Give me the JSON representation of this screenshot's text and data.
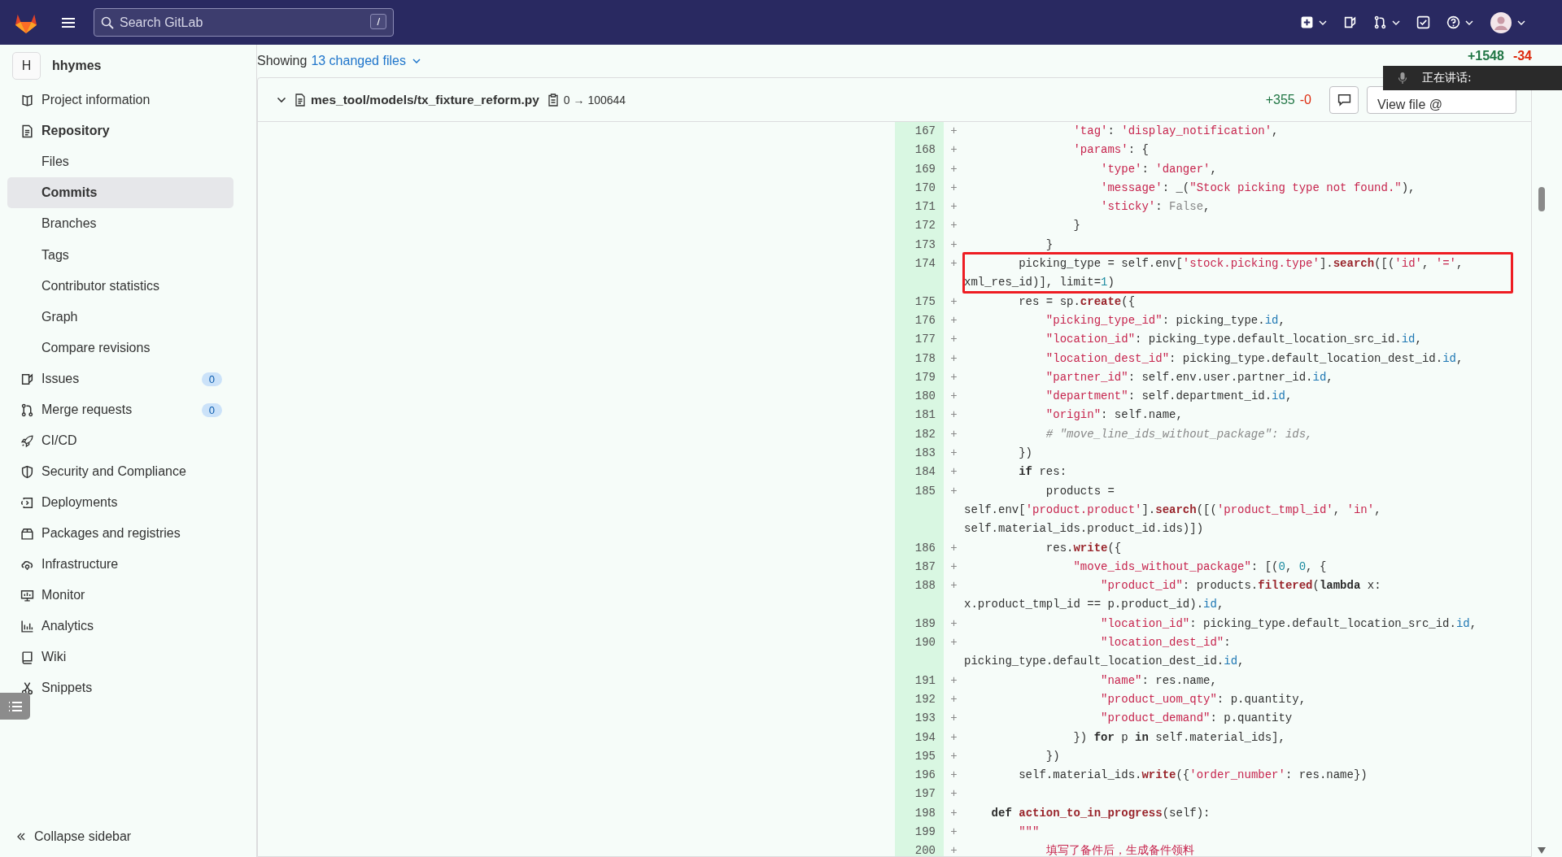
{
  "top_bar": {
    "search": {
      "placeholder": "Search GitLab",
      "shortcut": "/"
    }
  },
  "sidebar": {
    "project": {
      "initial": "H",
      "name": "hhymes"
    },
    "items": [
      {
        "label": "Project information",
        "selected": false
      },
      {
        "label": "Repository",
        "selected": false,
        "expanded": true,
        "children": [
          {
            "label": "Files",
            "selected": false
          },
          {
            "label": "Commits",
            "selected": true
          },
          {
            "label": "Branches",
            "selected": false
          },
          {
            "label": "Tags",
            "selected": false
          },
          {
            "label": "Contributor statistics",
            "selected": false
          },
          {
            "label": "Graph",
            "selected": false
          },
          {
            "label": "Compare revisions",
            "selected": false
          }
        ]
      },
      {
        "label": "Issues",
        "selected": false,
        "count": "0"
      },
      {
        "label": "Merge requests",
        "selected": false,
        "count": "0"
      },
      {
        "label": "CI/CD",
        "selected": false
      },
      {
        "label": "Security and Compliance",
        "selected": false
      },
      {
        "label": "Deployments",
        "selected": false
      },
      {
        "label": "Packages and registries",
        "selected": false
      },
      {
        "label": "Infrastructure",
        "selected": false
      },
      {
        "label": "Monitor",
        "selected": false
      },
      {
        "label": "Analytics",
        "selected": false
      },
      {
        "label": "Wiki",
        "selected": false
      },
      {
        "label": "Snippets",
        "selected": false
      }
    ],
    "collapse": "Collapse sidebar"
  },
  "summary": {
    "prefix": "Showing",
    "link": "13 changed files",
    "additions": "+1548",
    "deletions": "-34"
  },
  "voice_overlay": {
    "text": "正在讲话:"
  },
  "file": {
    "path": "mes_tool/models/tx_fixture_reform.py",
    "mode": "0 → 100644",
    "additions": "+355",
    "deletions": "-0",
    "view_button": "View file @",
    "expanded": true,
    "lines": [
      {
        "number": "167",
        "sign": "+",
        "highlighted": false,
        "tokens": [
          {
            "kind": "str",
            "text": "                'tag'"
          },
          {
            "kind": "plain",
            "text": ": "
          },
          {
            "kind": "str",
            "text": "'display_notification'"
          },
          {
            "kind": "plain",
            "text": ","
          }
        ]
      },
      {
        "number": "168",
        "sign": "+",
        "highlighted": false,
        "tokens": [
          {
            "kind": "str",
            "text": "                'params'"
          },
          {
            "kind": "plain",
            "text": ": {"
          }
        ]
      },
      {
        "number": "169",
        "sign": "+",
        "highlighted": false,
        "tokens": [
          {
            "kind": "str",
            "text": "                    'type'"
          },
          {
            "kind": "plain",
            "text": ": "
          },
          {
            "kind": "str",
            "text": "'danger'"
          },
          {
            "kind": "plain",
            "text": ","
          }
        ]
      },
      {
        "number": "170",
        "sign": "+",
        "highlighted": false,
        "tokens": [
          {
            "kind": "str",
            "text": "                    'message'"
          },
          {
            "kind": "plain",
            "text": ": _("
          },
          {
            "kind": "str",
            "text": "\"Stock picking type not found.\""
          },
          {
            "kind": "plain",
            "text": "),"
          }
        ]
      },
      {
        "number": "171",
        "sign": "+",
        "highlighted": false,
        "tokens": [
          {
            "kind": "str",
            "text": "                    'sticky'"
          },
          {
            "kind": "plain",
            "text": ": "
          },
          {
            "kind": "const",
            "text": "False"
          },
          {
            "kind": "plain",
            "text": ","
          }
        ]
      },
      {
        "number": "172",
        "sign": "+",
        "highlighted": false,
        "tokens": [
          {
            "kind": "plain",
            "text": "                }"
          }
        ]
      },
      {
        "number": "173",
        "sign": "+",
        "highlighted": false,
        "tokens": [
          {
            "kind": "plain",
            "text": "            }"
          }
        ]
      },
      {
        "number": "174",
        "sign": "+",
        "highlighted": true,
        "tokens": [
          {
            "kind": "plain",
            "text": "        picking_type = self.env["
          },
          {
            "kind": "str",
            "text": "'stock.picking.type'"
          },
          {
            "kind": "plain",
            "text": "]."
          },
          {
            "kind": "fn",
            "text": "search"
          },
          {
            "kind": "plain",
            "text": "([("
          },
          {
            "kind": "str",
            "text": "'id'"
          },
          {
            "kind": "plain",
            "text": ", "
          },
          {
            "kind": "str",
            "text": "'='"
          },
          {
            "kind": "plain",
            "text": ", xml_res_id)], limit="
          },
          {
            "kind": "num",
            "text": "1"
          },
          {
            "kind": "plain",
            "text": ")"
          }
        ]
      },
      {
        "number": "175",
        "sign": "+",
        "highlighted": false,
        "tokens": [
          {
            "kind": "plain",
            "text": "        res = sp."
          },
          {
            "kind": "fn",
            "text": "create"
          },
          {
            "kind": "plain",
            "text": "({"
          }
        ]
      },
      {
        "number": "176",
        "sign": "+",
        "highlighted": false,
        "tokens": [
          {
            "kind": "str",
            "text": "            \"picking_type_id\""
          },
          {
            "kind": "plain",
            "text": ": picking_type."
          },
          {
            "kind": "attr",
            "text": "id"
          },
          {
            "kind": "plain",
            "text": ","
          }
        ]
      },
      {
        "number": "177",
        "sign": "+",
        "highlighted": false,
        "tokens": [
          {
            "kind": "str",
            "text": "            \"location_id\""
          },
          {
            "kind": "plain",
            "text": ": picking_type.default_location_src_id."
          },
          {
            "kind": "attr",
            "text": "id"
          },
          {
            "kind": "plain",
            "text": ","
          }
        ]
      },
      {
        "number": "178",
        "sign": "+",
        "highlighted": false,
        "tokens": [
          {
            "kind": "str",
            "text": "            \"location_dest_id\""
          },
          {
            "kind": "plain",
            "text": ": picking_type.default_location_dest_id."
          },
          {
            "kind": "attr",
            "text": "id"
          },
          {
            "kind": "plain",
            "text": ","
          }
        ]
      },
      {
        "number": "179",
        "sign": "+",
        "highlighted": false,
        "tokens": [
          {
            "kind": "str",
            "text": "            \"partner_id\""
          },
          {
            "kind": "plain",
            "text": ": self.env.user.partner_id."
          },
          {
            "kind": "attr",
            "text": "id"
          },
          {
            "kind": "plain",
            "text": ","
          }
        ]
      },
      {
        "number": "180",
        "sign": "+",
        "highlighted": false,
        "tokens": [
          {
            "kind": "str",
            "text": "            \"department\""
          },
          {
            "kind": "plain",
            "text": ": self.department_id."
          },
          {
            "kind": "attr",
            "text": "id"
          },
          {
            "kind": "plain",
            "text": ","
          }
        ]
      },
      {
        "number": "181",
        "sign": "+",
        "highlighted": false,
        "tokens": [
          {
            "kind": "str",
            "text": "            \"origin\""
          },
          {
            "kind": "plain",
            "text": ": self.name,"
          }
        ]
      },
      {
        "number": "182",
        "sign": "+",
        "highlighted": false,
        "tokens": [
          {
            "kind": "comment",
            "text": "            # \"move_line_ids_without_package\": ids,"
          }
        ]
      },
      {
        "number": "183",
        "sign": "+",
        "highlighted": false,
        "tokens": [
          {
            "kind": "plain",
            "text": "        })"
          }
        ]
      },
      {
        "number": "184",
        "sign": "+",
        "highlighted": false,
        "tokens": [
          {
            "kind": "kw",
            "text": "        if"
          },
          {
            "kind": "plain",
            "text": " res:"
          }
        ]
      },
      {
        "number": "185",
        "sign": "+",
        "highlighted": false,
        "tokens": [
          {
            "kind": "plain",
            "text": "            products = self.env["
          },
          {
            "kind": "str",
            "text": "'product.product'"
          },
          {
            "kind": "plain",
            "text": "]."
          },
          {
            "kind": "fn",
            "text": "search"
          },
          {
            "kind": "plain",
            "text": "([("
          },
          {
            "kind": "str",
            "text": "'product_tmpl_id'"
          },
          {
            "kind": "plain",
            "text": ", "
          },
          {
            "kind": "str",
            "text": "'in'"
          },
          {
            "kind": "plain",
            "text": ", self.material_ids.product_id.ids)])"
          }
        ]
      },
      {
        "number": "186",
        "sign": "+",
        "highlighted": false,
        "tokens": [
          {
            "kind": "plain",
            "text": "            res."
          },
          {
            "kind": "fn",
            "text": "write"
          },
          {
            "kind": "plain",
            "text": "({"
          }
        ]
      },
      {
        "number": "187",
        "sign": "+",
        "highlighted": false,
        "tokens": [
          {
            "kind": "str",
            "text": "                \"move_ids_without_package\""
          },
          {
            "kind": "plain",
            "text": ": [("
          },
          {
            "kind": "num",
            "text": "0"
          },
          {
            "kind": "plain",
            "text": ", "
          },
          {
            "kind": "num",
            "text": "0"
          },
          {
            "kind": "plain",
            "text": ", {"
          }
        ]
      },
      {
        "number": "188",
        "sign": "+",
        "highlighted": false,
        "tokens": [
          {
            "kind": "str",
            "text": "                    \"product_id\""
          },
          {
            "kind": "plain",
            "text": ": products."
          },
          {
            "kind": "fn",
            "text": "filtered"
          },
          {
            "kind": "plain",
            "text": "("
          },
          {
            "kind": "kw",
            "text": "lambda"
          },
          {
            "kind": "plain",
            "text": " x: x.product_tmpl_id == p.product_id)."
          },
          {
            "kind": "attr",
            "text": "id"
          },
          {
            "kind": "plain",
            "text": ","
          }
        ]
      },
      {
        "number": "189",
        "sign": "+",
        "highlighted": false,
        "tokens": [
          {
            "kind": "str",
            "text": "                    \"location_id\""
          },
          {
            "kind": "plain",
            "text": ": picking_type.default_location_src_id."
          },
          {
            "kind": "attr",
            "text": "id"
          },
          {
            "kind": "plain",
            "text": ","
          }
        ]
      },
      {
        "number": "190",
        "sign": "+",
        "highlighted": false,
        "tokens": [
          {
            "kind": "str",
            "text": "                    \"location_dest_id\""
          },
          {
            "kind": "plain",
            "text": ": picking_type.default_location_dest_id."
          },
          {
            "kind": "attr",
            "text": "id"
          },
          {
            "kind": "plain",
            "text": ","
          }
        ]
      },
      {
        "number": "191",
        "sign": "+",
        "highlighted": false,
        "tokens": [
          {
            "kind": "str",
            "text": "                    \"name\""
          },
          {
            "kind": "plain",
            "text": ": res.name,"
          }
        ]
      },
      {
        "number": "192",
        "sign": "+",
        "highlighted": false,
        "tokens": [
          {
            "kind": "str",
            "text": "                    \"product_uom_qty\""
          },
          {
            "kind": "plain",
            "text": ": p.quantity,"
          }
        ]
      },
      {
        "number": "193",
        "sign": "+",
        "highlighted": false,
        "tokens": [
          {
            "kind": "str",
            "text": "                    \"product_demand\""
          },
          {
            "kind": "plain",
            "text": ": p.quantity"
          }
        ]
      },
      {
        "number": "194",
        "sign": "+",
        "highlighted": false,
        "tokens": [
          {
            "kind": "plain",
            "text": "                }) "
          },
          {
            "kind": "kw",
            "text": "for"
          },
          {
            "kind": "plain",
            "text": " p "
          },
          {
            "kind": "kw",
            "text": "in"
          },
          {
            "kind": "plain",
            "text": " self.material_ids],"
          }
        ]
      },
      {
        "number": "195",
        "sign": "+",
        "highlighted": false,
        "tokens": [
          {
            "kind": "plain",
            "text": "            })"
          }
        ]
      },
      {
        "number": "196",
        "sign": "+",
        "highlighted": false,
        "tokens": [
          {
            "kind": "plain",
            "text": "        self.material_ids."
          },
          {
            "kind": "fn",
            "text": "write"
          },
          {
            "kind": "plain",
            "text": "({"
          },
          {
            "kind": "str",
            "text": "'order_number'"
          },
          {
            "kind": "plain",
            "text": ": res.name})"
          }
        ]
      },
      {
        "number": "197",
        "sign": "+",
        "highlighted": false
      },
      {
        "number": "198",
        "sign": "+",
        "highlighted": false,
        "tokens": [
          {
            "kind": "kw",
            "text": "    def"
          },
          {
            "kind": "fn",
            "text": " action_to_in_progress"
          },
          {
            "kind": "plain",
            "text": "(self):"
          }
        ]
      },
      {
        "number": "199",
        "sign": "+",
        "highlighted": false,
        "tokens": [
          {
            "kind": "str",
            "text": "        \"\"\""
          }
        ]
      },
      {
        "number": "200",
        "sign": "+",
        "highlighted": false,
        "tokens": [
          {
            "kind": "str",
            "text": "            填写了备件后，生成备件领料"
          }
        ]
      }
    ]
  }
}
